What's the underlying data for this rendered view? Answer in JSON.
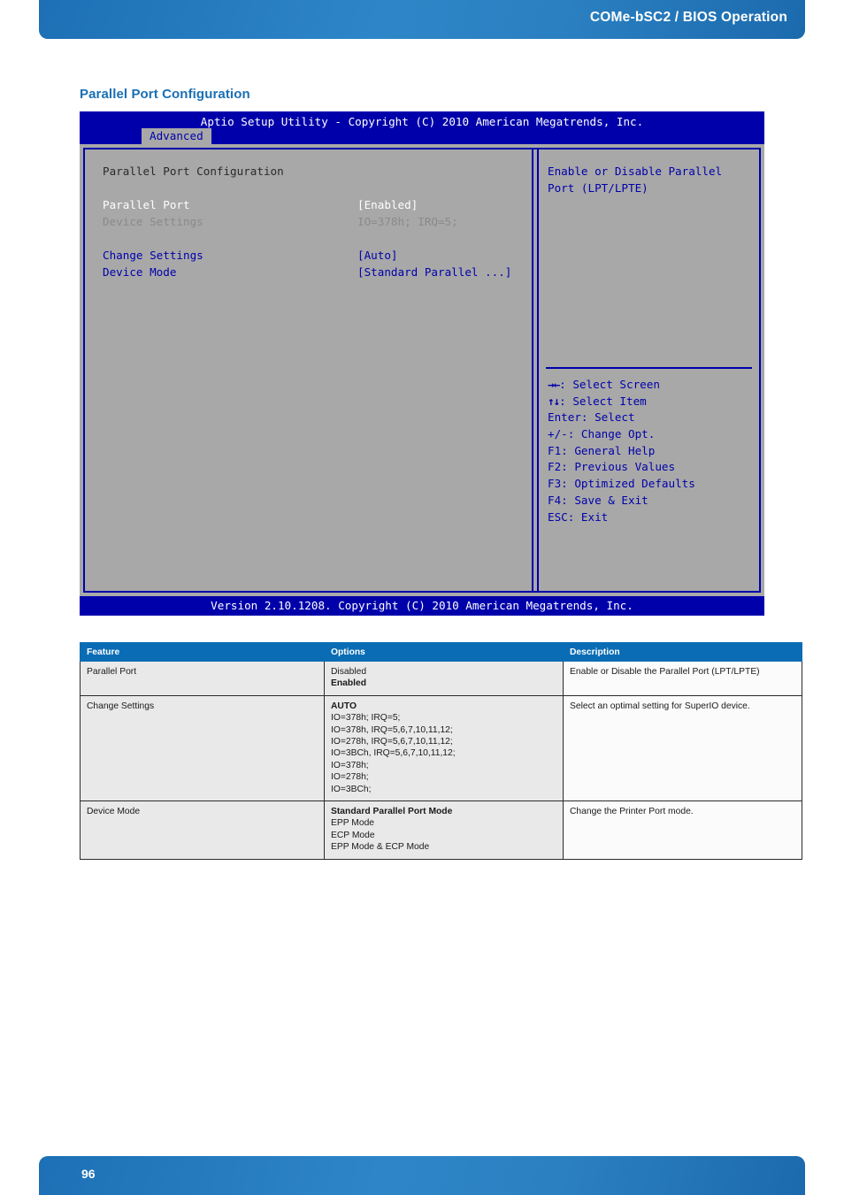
{
  "header": {
    "title": "COMe-bSC2 / BIOS Operation"
  },
  "section": {
    "title": "Parallel Port Configuration"
  },
  "bios": {
    "titlebar": "Aptio Setup Utility - Copyright (C) 2010 American Megatrends, Inc.",
    "tab": "Advanced",
    "panel_heading": "Parallel Port Configuration",
    "rows": [
      {
        "label": "Parallel Port",
        "value": "[Enabled]"
      },
      {
        "label": "Device Settings",
        "value": "IO=378h; IRQ=5;"
      },
      {
        "label": "Change Settings",
        "value": "[Auto]"
      },
      {
        "label": "Device Mode",
        "value": "[Standard Parallel ...]"
      }
    ],
    "help": {
      "line1": "Enable or Disable Parallel",
      "line2": "Port (LPT/LPTE)"
    },
    "keys": [
      {
        "glyph": "→←",
        "text": ": Select Screen"
      },
      {
        "glyph": "↑↓",
        "text": ": Select Item"
      },
      {
        "glyph": "Enter",
        "text": ": Select"
      },
      {
        "glyph": "+/-",
        "text": ": Change Opt."
      },
      {
        "glyph": "F1",
        "text": ": General Help"
      },
      {
        "glyph": "F2",
        "text": ": Previous Values"
      },
      {
        "glyph": "F3",
        "text": ": Optimized Defaults"
      },
      {
        "glyph": "F4",
        "text": ": Save & Exit"
      },
      {
        "glyph": "ESC",
        "text": ": Exit"
      }
    ],
    "version": "Version 2.10.1208. Copyright (C) 2010 American Megatrends, Inc."
  },
  "table": {
    "headers": {
      "feature": "Feature",
      "options": "Options",
      "description": "Description"
    },
    "rows": [
      {
        "feature": "Parallel Port",
        "options": [
          {
            "text": "Disabled",
            "bold": false
          },
          {
            "text": "Enabled",
            "bold": true
          }
        ],
        "description": "Enable or Disable the Parallel Port (LPT/LPTE)"
      },
      {
        "feature": "Change Settings",
        "options": [
          {
            "text": "AUTO",
            "bold": true
          },
          {
            "text": "IO=378h; IRQ=5;",
            "bold": false
          },
          {
            "text": "IO=378h, IRQ=5,6,7,10,11,12;",
            "bold": false
          },
          {
            "text": "IO=278h, IRQ=5,6,7,10,11,12;",
            "bold": false
          },
          {
            "text": "IO=3BCh, IRQ=5,6,7,10,11,12;",
            "bold": false
          },
          {
            "text": "IO=378h;",
            "bold": false
          },
          {
            "text": "IO=278h;",
            "bold": false
          },
          {
            "text": "IO=3BCh;",
            "bold": false
          }
        ],
        "description": "Select an optimal setting for SuperIO device."
      },
      {
        "feature": "Device Mode",
        "options": [
          {
            "text": "Standard Parallel Port Mode",
            "bold": true
          },
          {
            "text": "EPP Mode",
            "bold": false
          },
          {
            "text": "ECP Mode",
            "bold": false
          },
          {
            "text": "EPP Mode & ECP Mode",
            "bold": false
          }
        ],
        "description": "Change the Printer Port mode."
      }
    ]
  },
  "footer": {
    "page_number": "96"
  },
  "colors": {
    "brand_blue": "#1d70b5",
    "table_header_blue": "#0a6cb4",
    "bios_blue": "#0000ab",
    "bios_gray": "#a8a8a8"
  }
}
